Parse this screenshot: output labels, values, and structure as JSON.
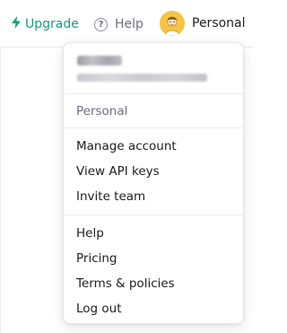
{
  "header": {
    "upgrade_label": "Upgrade",
    "help_label": "Help",
    "account_label": "Personal"
  },
  "menu": {
    "organization": "Personal",
    "account_items": [
      {
        "label": "Manage account"
      },
      {
        "label": "View API keys"
      },
      {
        "label": "Invite team"
      }
    ],
    "general_items": [
      {
        "label": "Help"
      },
      {
        "label": "Pricing"
      },
      {
        "label": "Terms & policies"
      },
      {
        "label": "Log out"
      }
    ]
  },
  "colors": {
    "accent": "#10a37f",
    "avatar_bg": "#f5c542",
    "muted_text": "#6e6e80",
    "text": "#202123",
    "divider": "#ececf1"
  },
  "icons": {
    "upgrade": "lightning-bolt-icon",
    "help": "question-circle-icon",
    "avatar": "user-avatar-icon"
  }
}
